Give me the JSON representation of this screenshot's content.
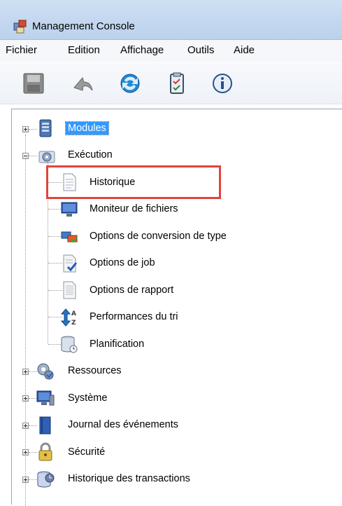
{
  "window": {
    "title": "Management Console"
  },
  "menu": [
    "Fichier",
    "Edition",
    "Affichage",
    "Outils",
    "Aide"
  ],
  "toolbar": [
    {
      "icon": "save-icon"
    },
    {
      "icon": "undo-icon"
    },
    {
      "icon": "refresh-icon"
    },
    {
      "icon": "clipboard-icon"
    },
    {
      "icon": "info-icon"
    }
  ],
  "tree": {
    "root_items": [
      {
        "label": "Modules",
        "icon": "server-icon",
        "expander": "plus",
        "selected": true
      },
      {
        "label": "Exécution",
        "icon": "gear-icon",
        "expander": "minus",
        "selected": false,
        "children": [
          {
            "label": "Historique",
            "icon": "document-icon"
          },
          {
            "label": "Moniteur de fichiers",
            "icon": "monitor-icon"
          },
          {
            "label": "Options de conversion de type",
            "icon": "conversion-icon"
          },
          {
            "label": "Options de job",
            "icon": "job-options-icon"
          },
          {
            "label": "Options de rapport",
            "icon": "report-icon"
          },
          {
            "label": "Performances du tri",
            "icon": "sort-icon"
          },
          {
            "label": "Planification",
            "icon": "database-clock-icon"
          }
        ]
      },
      {
        "label": "Ressources",
        "icon": "resources-gear-icon",
        "expander": "plus",
        "selected": false
      },
      {
        "label": "Système",
        "icon": "computer-icon",
        "expander": "plus",
        "selected": false
      },
      {
        "label": "Journal des événements",
        "icon": "book-icon",
        "expander": "plus",
        "selected": false
      },
      {
        "label": "Sécurité",
        "icon": "lock-icon",
        "expander": "plus",
        "selected": false
      },
      {
        "label": "Historique des transactions",
        "icon": "database-clock-icon",
        "expander": "plus",
        "selected": false
      }
    ]
  },
  "colors": {
    "selection": "#3399ff",
    "highlight_box": "#e0443c",
    "titlebar": "#c3d7ef"
  }
}
